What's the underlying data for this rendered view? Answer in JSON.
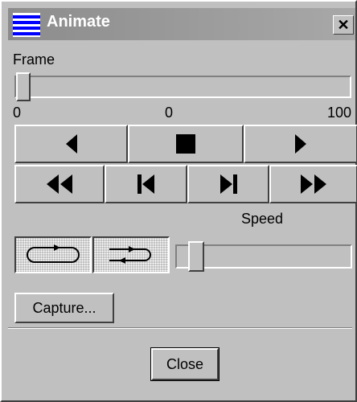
{
  "window": {
    "title": "Animate",
    "title_icon": "animate-app-icon",
    "close_glyph": "✕"
  },
  "frame": {
    "label": "Frame",
    "min": "0",
    "current": "0",
    "max": "100",
    "position_fraction": 0.0
  },
  "playback": {
    "row1": [
      {
        "name": "play-backward-button",
        "icon": "play-backward-icon"
      },
      {
        "name": "stop-button",
        "icon": "stop-icon"
      },
      {
        "name": "play-forward-button",
        "icon": "play-forward-icon"
      }
    ],
    "row2": [
      {
        "name": "rewind-button",
        "icon": "rewind-icon"
      },
      {
        "name": "first-frame-button",
        "icon": "first-frame-icon"
      },
      {
        "name": "last-frame-button",
        "icon": "last-frame-icon"
      },
      {
        "name": "fast-forward-button",
        "icon": "fast-forward-icon"
      }
    ]
  },
  "speed": {
    "label": "Speed",
    "position_fraction": 0.07
  },
  "loop_modes": [
    "loop-icon",
    "bounce-icon"
  ],
  "buttons": {
    "capture": "Capture...",
    "close": "Close"
  }
}
